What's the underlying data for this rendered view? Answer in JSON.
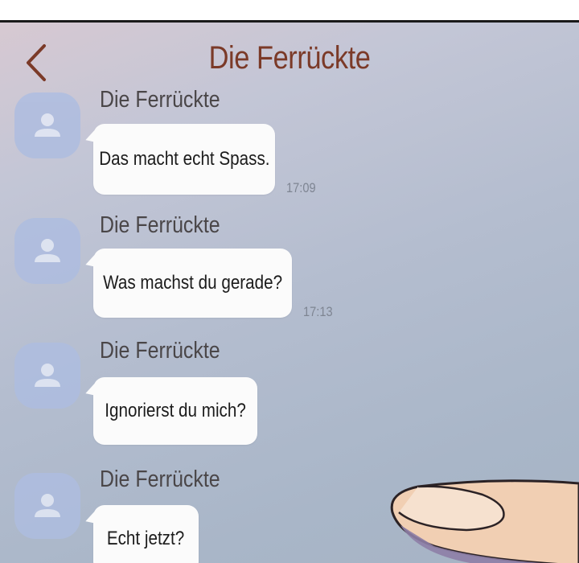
{
  "header": {
    "title": "Die Ferrückte",
    "back_icon": "chevron-left-icon"
  },
  "colors": {
    "title": "#7b3a28",
    "background": "#b4bdcf",
    "bubble": "#fbfbfb",
    "avatar": "#aebde0"
  },
  "messages": [
    {
      "sender": "Die Ferrückte",
      "text": "Das macht echt Spass.",
      "time": "17:09"
    },
    {
      "sender": "Die Ferrückte",
      "text": "Was machst du gerade?",
      "time": "17:13"
    },
    {
      "sender": "Die Ferrückte",
      "text": "Ignorierst du mich?",
      "time": ""
    },
    {
      "sender": "Die Ferrückte",
      "text": "Echt jetzt?",
      "time": ""
    }
  ]
}
